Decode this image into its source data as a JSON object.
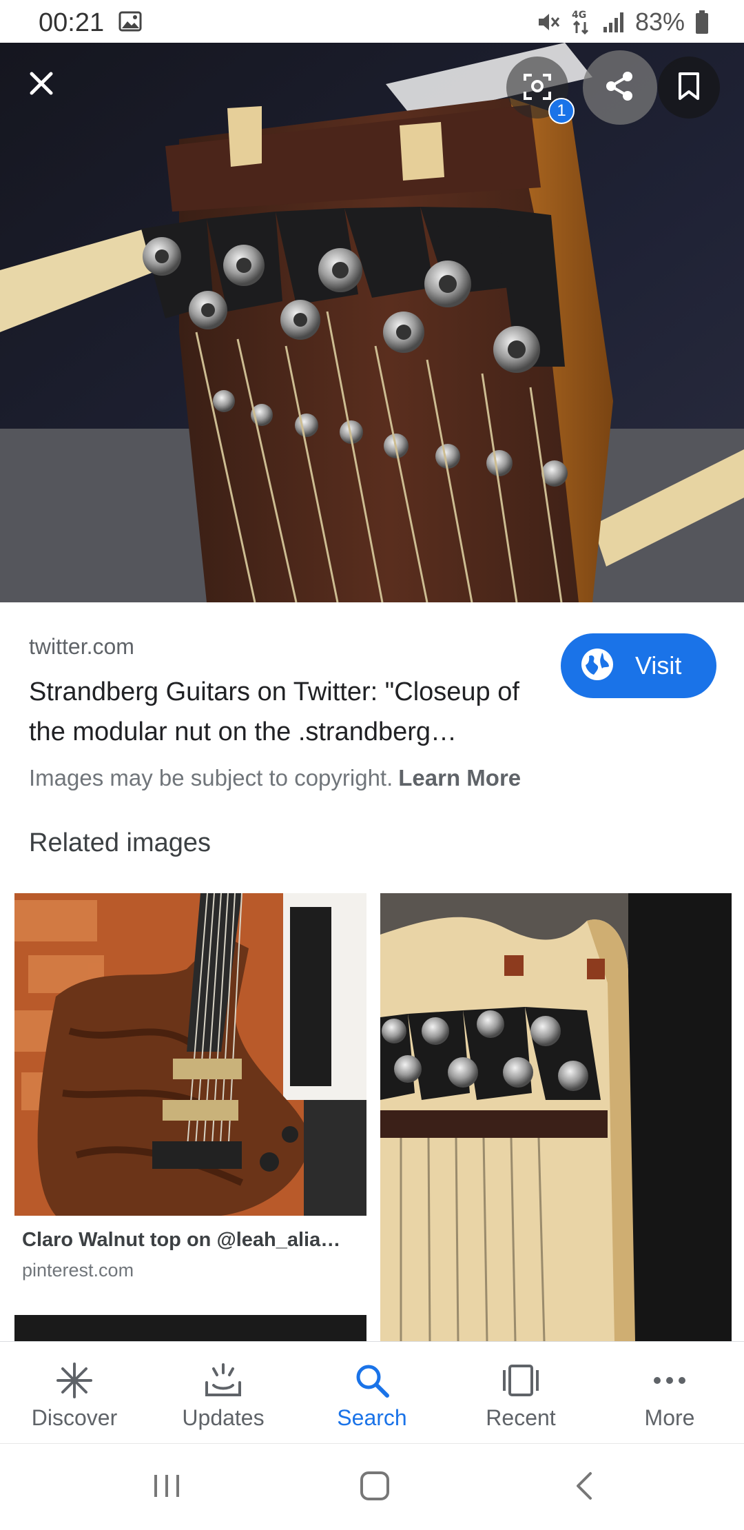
{
  "status_bar": {
    "time": "00:21",
    "battery": "83%",
    "network": "4G",
    "icons": [
      "image-icon",
      "mute-icon",
      "network-4g-icon",
      "signal-icon",
      "battery-icon"
    ]
  },
  "hero": {
    "lens_badge": "1",
    "icons": [
      "close-icon",
      "lens-icon",
      "share-icon",
      "bookmark-icon"
    ]
  },
  "result": {
    "source": "twitter.com",
    "title": "Strandberg Guitars on Twitter: \"Closeup of the modular nut on the .strandberg…",
    "copyright_text": "Images may be subject to copyright.",
    "learn_more": "Learn More",
    "visit_label": "Visit"
  },
  "related": {
    "heading": "Related images",
    "items": [
      {
        "caption": "Claro Walnut top on @leah_alia…",
        "domain": "pinterest.com"
      }
    ]
  },
  "bottom_nav": {
    "items": [
      {
        "label": "Discover",
        "icon": "asterisk-icon"
      },
      {
        "label": "Updates",
        "icon": "updates-icon"
      },
      {
        "label": "Search",
        "icon": "search-icon",
        "active": true
      },
      {
        "label": "Recent",
        "icon": "recent-icon"
      },
      {
        "label": "More",
        "icon": "more-dots-icon"
      }
    ]
  },
  "colors": {
    "accent": "#1a73e8",
    "text_primary": "#202124",
    "text_secondary": "#5f6368"
  }
}
